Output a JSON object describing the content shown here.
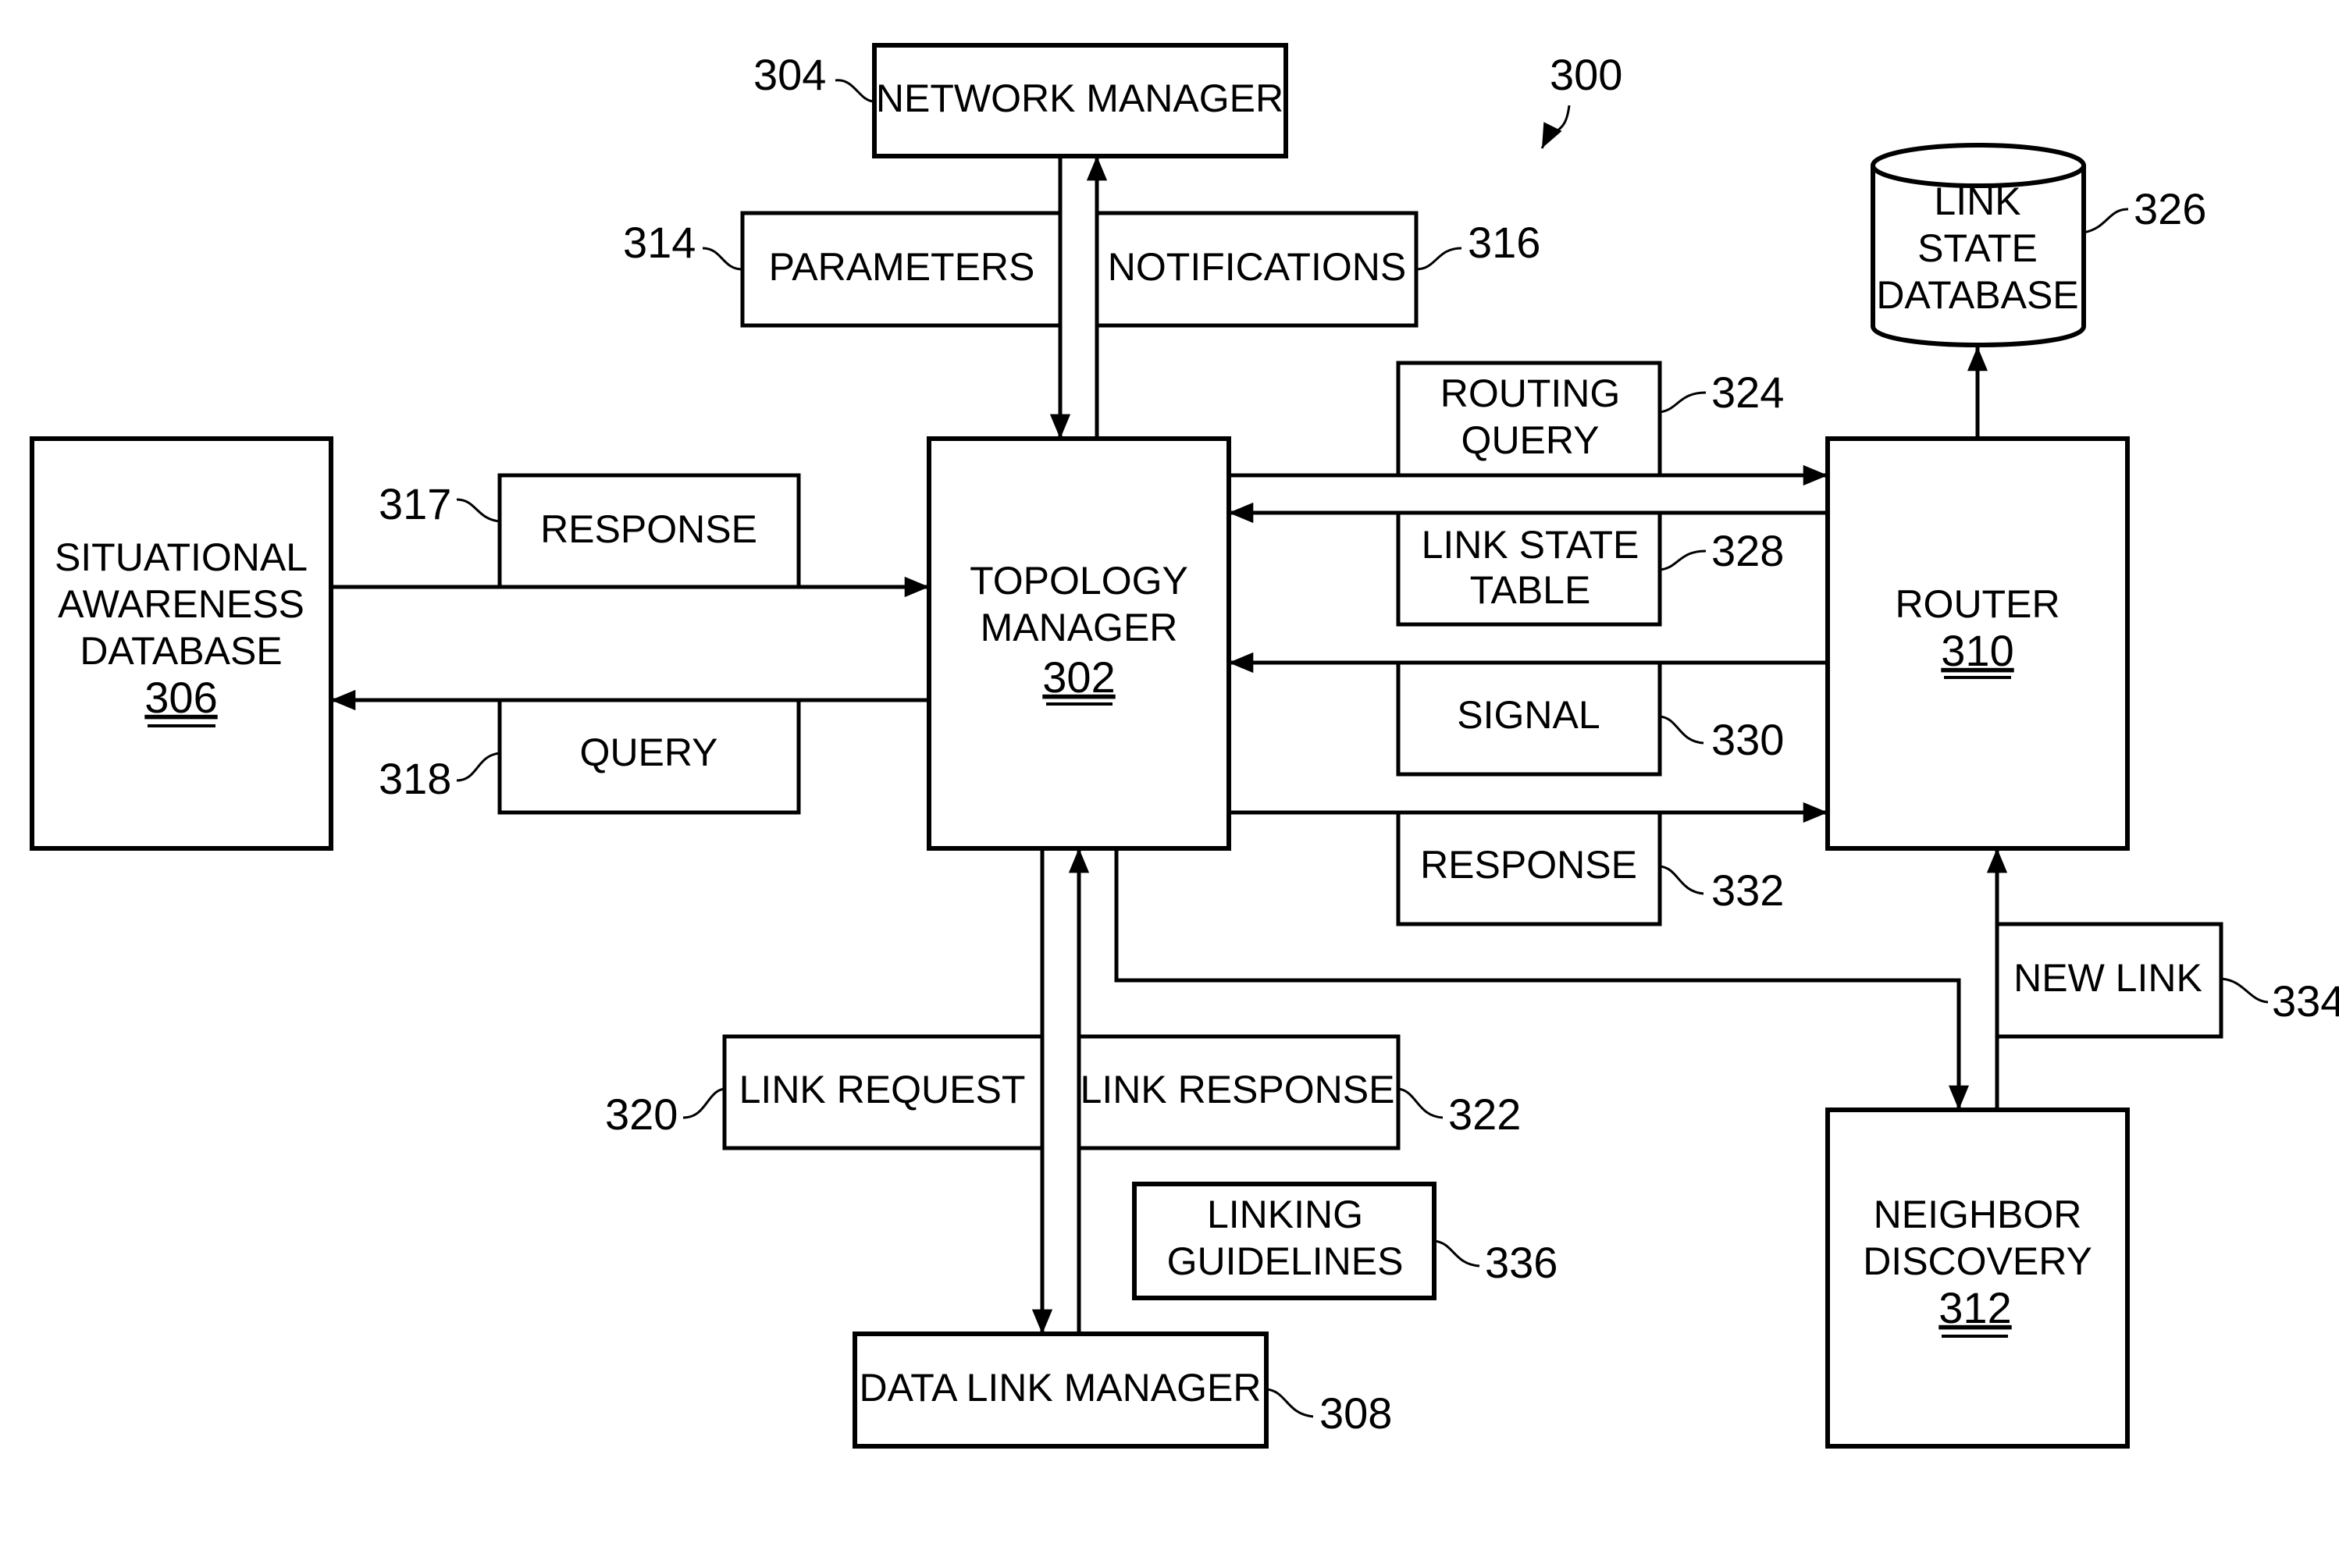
{
  "figure": {
    "ref": "300"
  },
  "nodes": {
    "network_manager": {
      "label": "NETWORK MANAGER",
      "ref": "304"
    },
    "topology_manager": {
      "lines": [
        "TOPOLOGY",
        "MANAGER"
      ],
      "number": "302"
    },
    "situational_awareness_db": {
      "lines": [
        "SITUATIONAL",
        "AWARENESS",
        "DATABASE"
      ],
      "number": "306"
    },
    "router": {
      "lines": [
        "ROUTER"
      ],
      "number": "310"
    },
    "link_state_db": {
      "lines": [
        "LINK",
        "STATE",
        "DATABASE"
      ],
      "ref": "326"
    },
    "neighbor_discovery": {
      "lines": [
        "NEIGHBOR",
        "DISCOVERY"
      ],
      "number": "312"
    },
    "data_link_manager": {
      "label": "DATA LINK MANAGER",
      "ref": "308"
    }
  },
  "messages": {
    "parameters": {
      "label": "PARAMETERS",
      "ref": "314"
    },
    "notifications": {
      "label": "NOTIFICATIONS",
      "ref": "316"
    },
    "sa_response": {
      "label": "RESPONSE",
      "ref": "317"
    },
    "sa_query": {
      "label": "QUERY",
      "ref": "318"
    },
    "routing_query": {
      "lines": [
        "ROUTING",
        "QUERY"
      ],
      "ref": "324"
    },
    "link_state_table": {
      "lines": [
        "LINK STATE",
        "TABLE"
      ],
      "ref": "328"
    },
    "signal": {
      "label": "SIGNAL",
      "ref": "330"
    },
    "router_response": {
      "label": "RESPONSE",
      "ref": "332"
    },
    "new_link": {
      "label": "NEW LINK",
      "ref": "334"
    },
    "link_request": {
      "label": "LINK REQUEST",
      "ref": "320"
    },
    "link_response": {
      "label": "LINK RESPONSE",
      "ref": "322"
    },
    "linking_guidelines": {
      "lines": [
        "LINKING",
        "GUIDELINES"
      ],
      "ref": "336"
    }
  }
}
